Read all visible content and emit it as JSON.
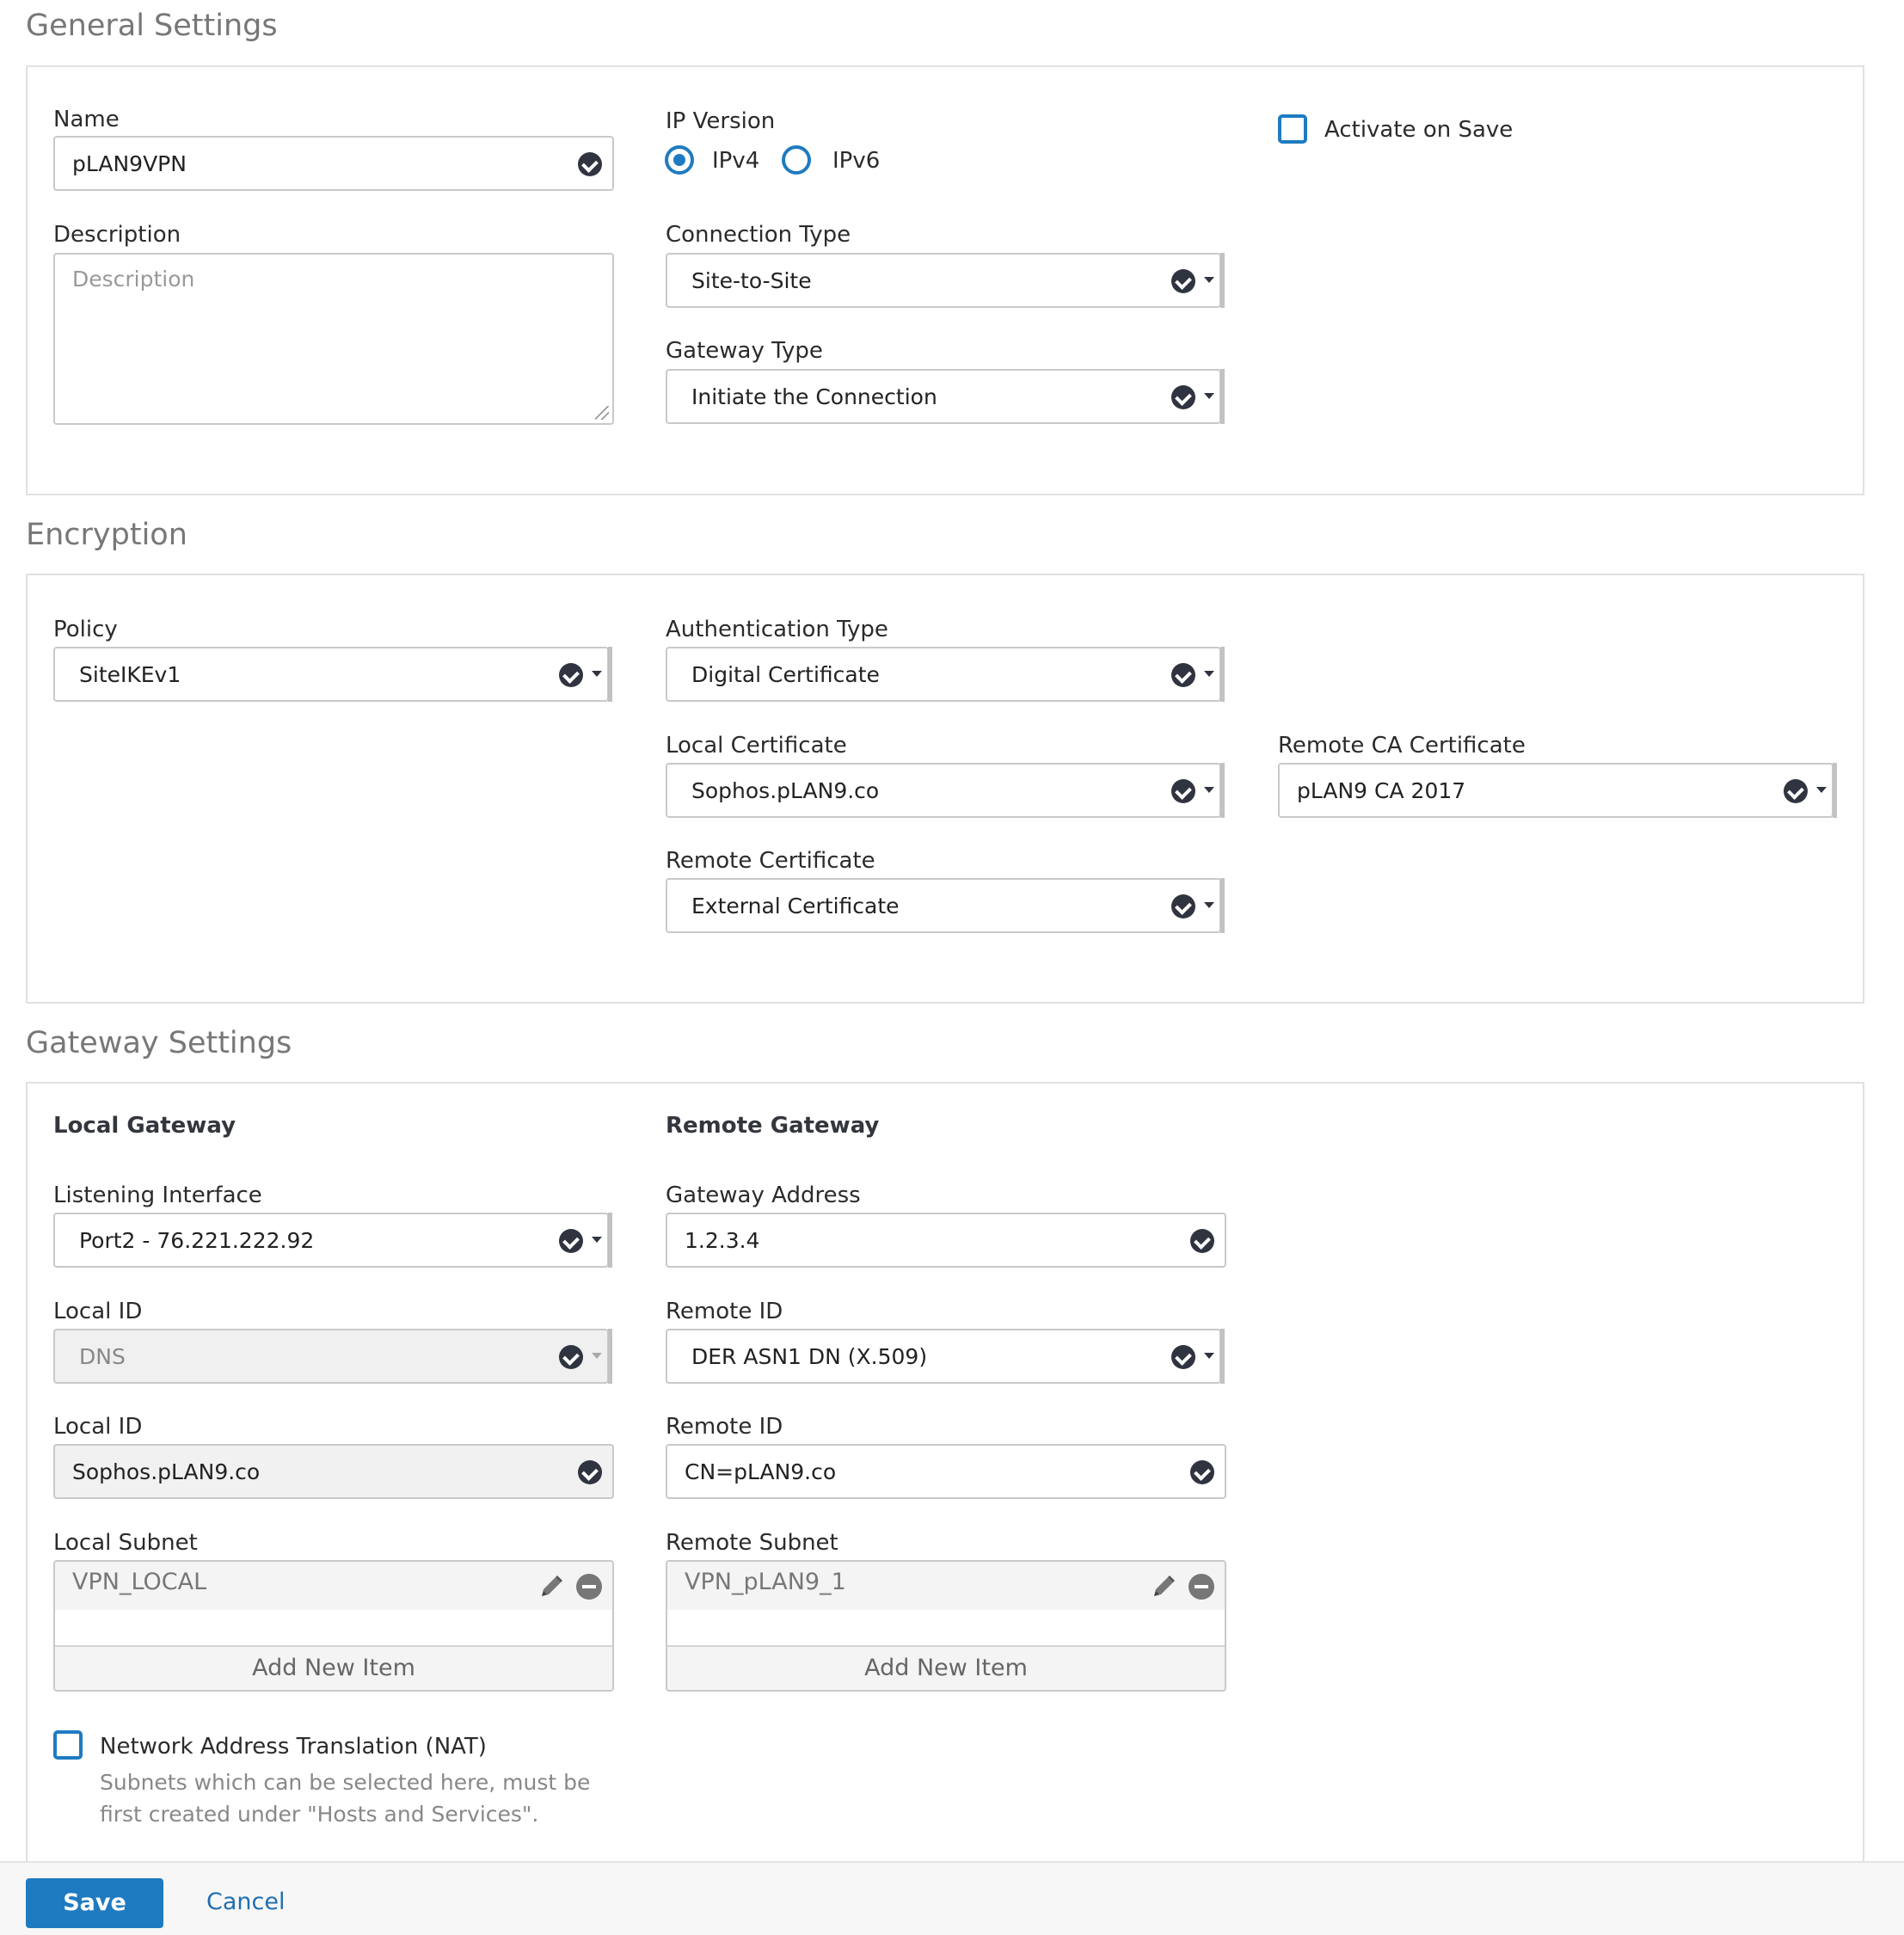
{
  "general": {
    "title": "General Settings",
    "name_label": "Name",
    "name_value": "pLAN9VPN",
    "description_label": "Description",
    "description_placeholder": "Description",
    "ip_version_label": "IP Version",
    "ipv4_label": "IPv4",
    "ipv6_label": "IPv6",
    "ip_version_selected": "IPv4",
    "activate_label": "Activate on Save",
    "activate_checked": false,
    "connection_type_label": "Connection Type",
    "connection_type_value": "Site-to-Site",
    "gateway_type_label": "Gateway Type",
    "gateway_type_value": "Initiate the Connection"
  },
  "encryption": {
    "title": "Encryption",
    "policy_label": "Policy",
    "policy_value": "SiteIKEv1",
    "auth_type_label": "Authentication Type",
    "auth_type_value": "Digital Certificate",
    "local_cert_label": "Local Certificate",
    "local_cert_value": "Sophos.pLAN9.co",
    "remote_ca_label": "Remote CA Certificate",
    "remote_ca_value": "pLAN9 CA 2017",
    "remote_cert_label": "Remote Certificate",
    "remote_cert_value": "External Certificate"
  },
  "gateway": {
    "title": "Gateway Settings",
    "local_heading": "Local Gateway",
    "remote_heading": "Remote Gateway",
    "listening_label": "Listening Interface",
    "listening_value": "Port2 - 76.221.222.92",
    "gateway_address_label": "Gateway Address",
    "gateway_address_value": "1.2.3.4",
    "local_id_type_label": "Local ID",
    "local_id_type_value": "DNS",
    "remote_id_type_label": "Remote ID",
    "remote_id_type_value": "DER ASN1 DN (X.509)",
    "local_id_label": "Local ID",
    "local_id_value": "Sophos.pLAN9.co",
    "remote_id_label": "Remote ID",
    "remote_id_value": "CN=pLAN9.co",
    "local_subnet_label": "Local Subnet",
    "local_subnet_item": "VPN_LOCAL",
    "remote_subnet_label": "Remote Subnet",
    "remote_subnet_item": "VPN_pLAN9_1",
    "add_new_item": "Add New Item",
    "nat_label": "Network Address Translation (NAT)",
    "nat_checked": false,
    "nat_hint_1": "Subnets which can be selected here, must be",
    "nat_hint_2": "first created under \"Hosts and Services\"."
  },
  "footer": {
    "save_label": "Save",
    "cancel_label": "Cancel"
  },
  "icons": {
    "valid": "check-circle-icon",
    "dropdown": "caret-down-icon",
    "edit": "pencil-icon",
    "remove": "minus-circle-icon"
  },
  "colors": {
    "accent": "#1f7bc1",
    "valid_icon": "#2f3440"
  }
}
